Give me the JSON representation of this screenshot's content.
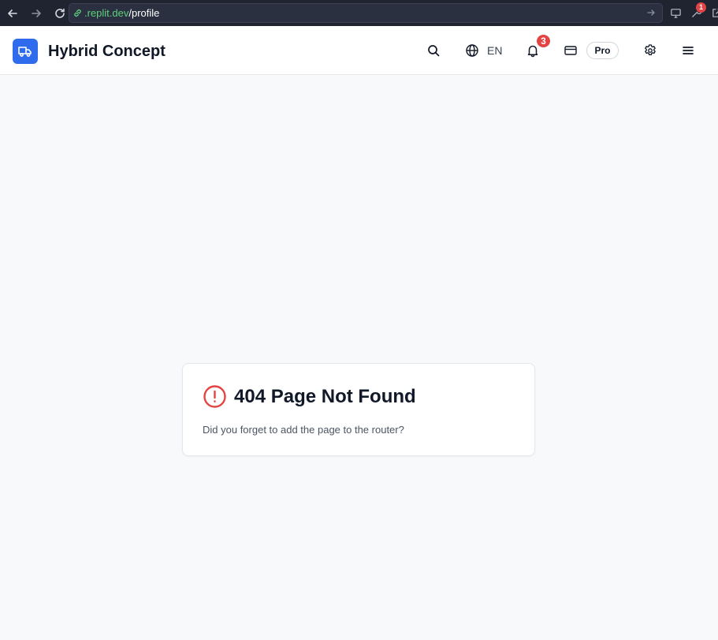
{
  "browser": {
    "url_host": ".replit.dev",
    "url_path": "/profile",
    "extension_badge": "1"
  },
  "header": {
    "brand_name": "Hybrid Concept",
    "language": "EN",
    "notification_count": "3",
    "plan": "Pro"
  },
  "not_found": {
    "title": "404 Page Not Found",
    "message": "Did you forget to add the page to the router?"
  },
  "colors": {
    "brand": "#2f6bed",
    "danger": "#e34343",
    "url_host": "#5fcf7d"
  },
  "icons": {
    "back": "arrow-left-icon",
    "forward": "arrow-right-icon",
    "reload": "reload-icon",
    "link": "link-icon",
    "search": "search-icon",
    "language": "globe-icon",
    "notifications": "bell-icon",
    "billing": "credit-card-icon",
    "settings": "gear-icon",
    "menu": "hamburger-menu-icon",
    "logo": "truck-icon",
    "error": "alert-circle-icon"
  }
}
